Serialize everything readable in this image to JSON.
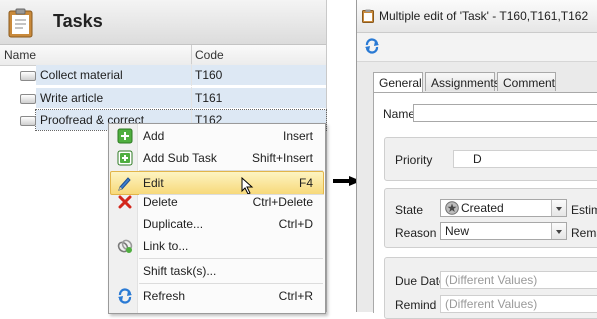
{
  "tasks_panel": {
    "title": "Tasks",
    "columns": {
      "name": "Name",
      "code": "Code"
    },
    "rows": [
      {
        "name": "Collect material",
        "code": "T160"
      },
      {
        "name": "Write article",
        "code": "T161"
      },
      {
        "name": "Proofread & correct",
        "code": "T162"
      }
    ]
  },
  "context_menu": {
    "items": [
      {
        "label": "Add",
        "shortcut": "Insert",
        "icon": "add-icon"
      },
      {
        "label": "Add Sub Task",
        "shortcut": "Shift+Insert",
        "icon": "add-subtask-icon"
      },
      {
        "label": "Edit",
        "shortcut": "F4",
        "icon": "pencil-icon"
      },
      {
        "label": "Delete",
        "shortcut": "Ctrl+Delete",
        "icon": "delete-x-icon"
      },
      {
        "label": "Duplicate...",
        "shortcut": "Ctrl+D",
        "icon": ""
      },
      {
        "label": "Link to...",
        "shortcut": "",
        "icon": "link-icon"
      },
      {
        "label": "Shift task(s)...",
        "shortcut": "",
        "icon": ""
      },
      {
        "label": "Refresh",
        "shortcut": "Ctrl+R",
        "icon": "refresh-icon"
      }
    ]
  },
  "dialog": {
    "title": "Multiple edit of 'Task' - T160,T161,T162",
    "tabs": [
      "General",
      "Assignments",
      "Comment"
    ],
    "fields": {
      "name_label": "Name",
      "name_value": "",
      "priority_label": "Priority",
      "priority_value": "D",
      "state_label": "State",
      "state_value": "Created",
      "reason_label": "Reason",
      "reason_value": "New",
      "estimate_label": "Estima",
      "remarks_label": "Rema",
      "due_date_label": "Due Date",
      "due_date_placeholder": "(Different Values)",
      "remind_label": "Remind",
      "remind_placeholder": "(Different Values)"
    }
  },
  "colors": {
    "selection": "#dde8f4",
    "highlight": "#f7d97a",
    "accent_blue": "#2a7ad4"
  }
}
